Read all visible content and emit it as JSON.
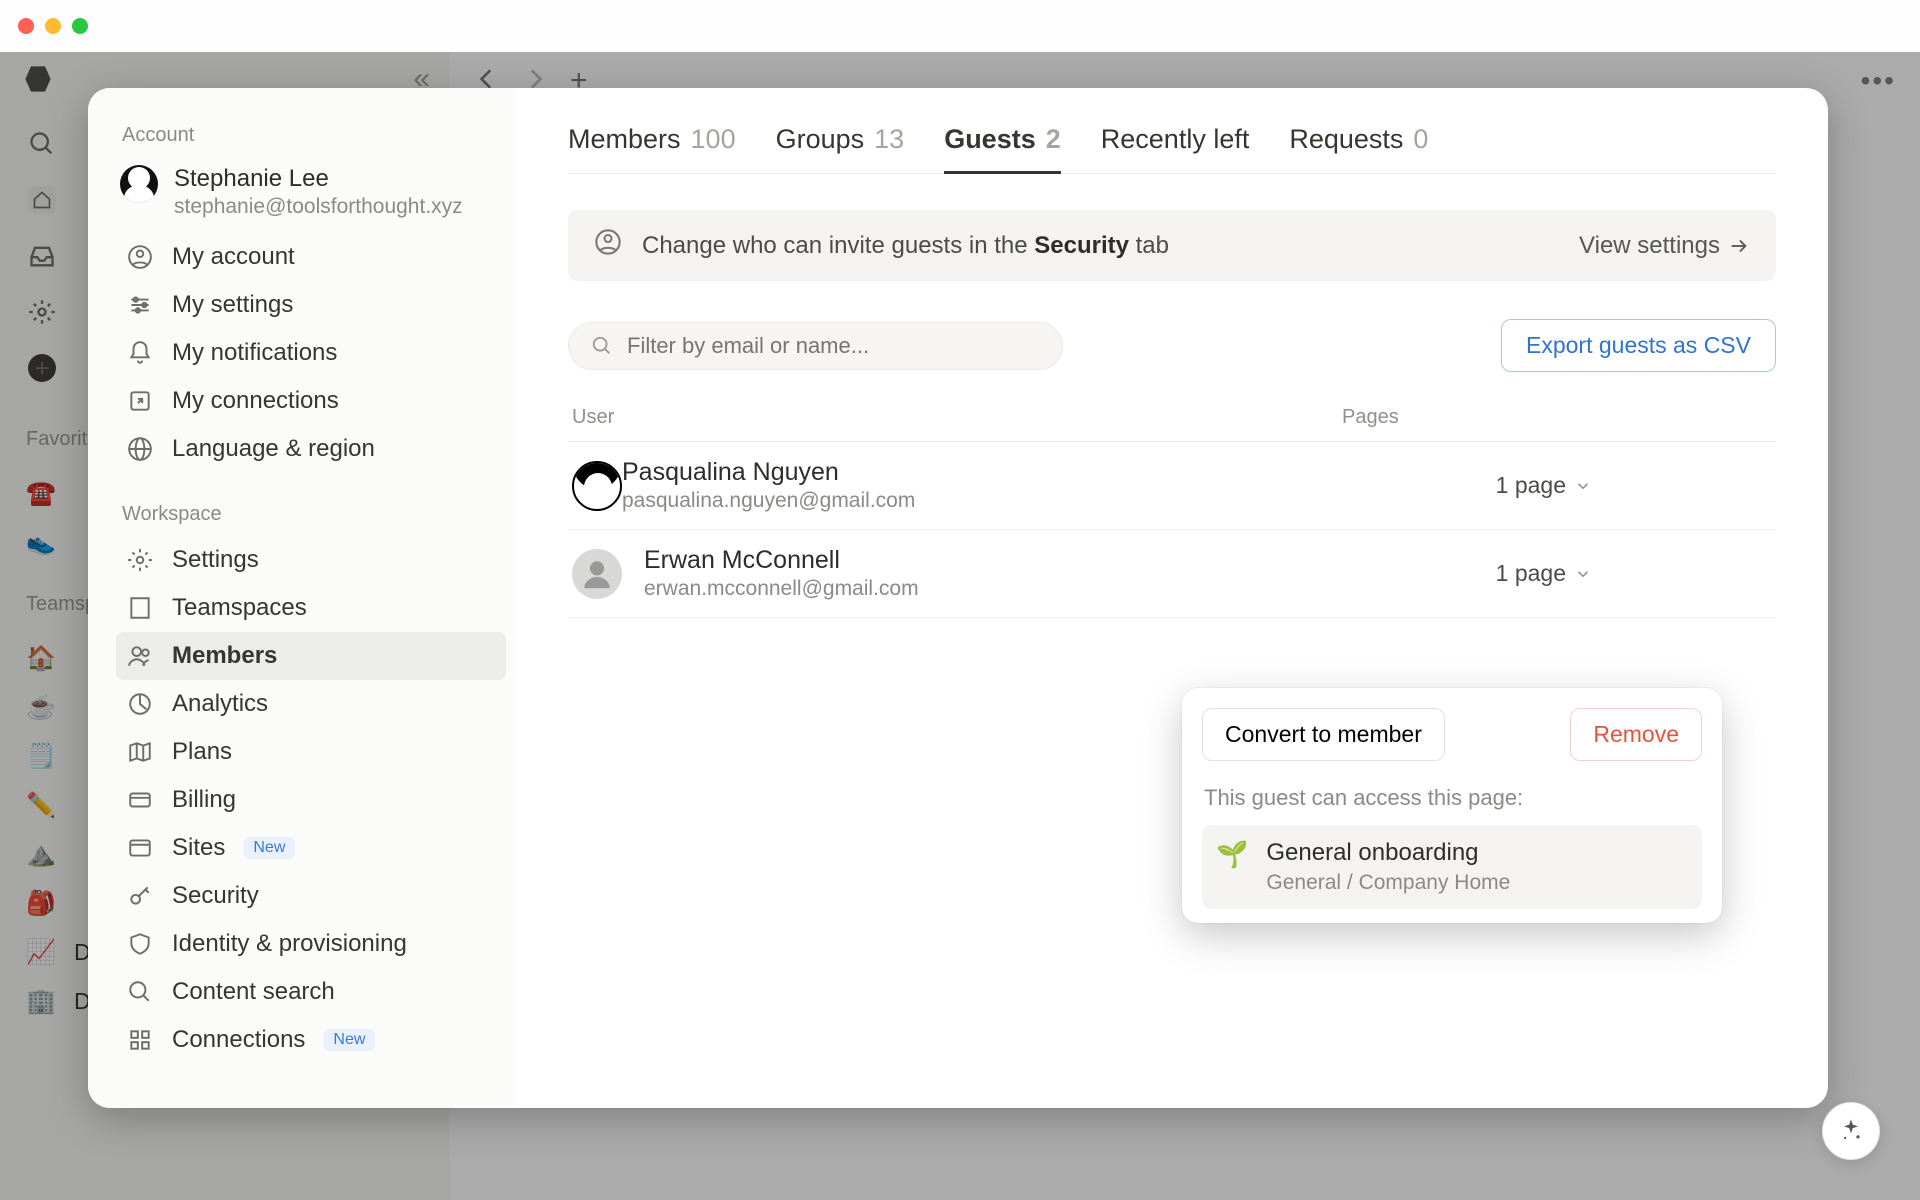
{
  "window": {
    "dots": "•••"
  },
  "app_rail": {
    "favorites_label": "Favorites",
    "teamspaces_label": "Teamspaces",
    "items": [
      {
        "emoji": "☎️",
        "label": ""
      },
      {
        "emoji": "👟",
        "label": ""
      }
    ],
    "team_items": [
      {
        "emoji": "🏠",
        "label": ""
      },
      {
        "emoji": "☕",
        "label": ""
      },
      {
        "emoji": "🗒️",
        "label": ""
      },
      {
        "emoji": "✏️",
        "label": ""
      },
      {
        "emoji": "⛰️",
        "label": ""
      },
      {
        "emoji": "🎒",
        "label": ""
      },
      {
        "emoji": "📈",
        "label": "Data"
      },
      {
        "emoji": "🏢",
        "label": "Data Home"
      }
    ]
  },
  "sidebar": {
    "section_account": "Account",
    "user": {
      "name": "Stephanie Lee",
      "email": "stephanie@toolsforthought.xyz"
    },
    "account_items": [
      {
        "key": "my-account",
        "label": "My account"
      },
      {
        "key": "my-settings",
        "label": "My settings"
      },
      {
        "key": "my-notifications",
        "label": "My notifications"
      },
      {
        "key": "my-connections",
        "label": "My connections"
      },
      {
        "key": "language",
        "label": "Language & region"
      }
    ],
    "section_workspace": "Workspace",
    "workspace_items": [
      {
        "key": "settings",
        "label": "Settings"
      },
      {
        "key": "teamspaces",
        "label": "Teamspaces"
      },
      {
        "key": "members",
        "label": "Members",
        "active": true
      },
      {
        "key": "analytics",
        "label": "Analytics"
      },
      {
        "key": "plans",
        "label": "Plans"
      },
      {
        "key": "billing",
        "label": "Billing"
      },
      {
        "key": "sites",
        "label": "Sites",
        "badge": "New"
      },
      {
        "key": "security",
        "label": "Security"
      },
      {
        "key": "identity",
        "label": "Identity & provisioning"
      },
      {
        "key": "content-search",
        "label": "Content search"
      },
      {
        "key": "connections",
        "label": "Connections",
        "badge": "New"
      }
    ]
  },
  "tabs": [
    {
      "key": "members",
      "label": "Members",
      "count": "100"
    },
    {
      "key": "groups",
      "label": "Groups",
      "count": "13"
    },
    {
      "key": "guests",
      "label": "Guests",
      "count": "2",
      "active": true
    },
    {
      "key": "recently-left",
      "label": "Recently left",
      "count": ""
    },
    {
      "key": "requests",
      "label": "Requests",
      "count": "0"
    }
  ],
  "banner": {
    "text_pre": "Change who can invite guests in the ",
    "text_bold": "Security",
    "text_post": " tab",
    "action": "View settings"
  },
  "filter": {
    "placeholder": "Filter by email or name..."
  },
  "export_label": "Export guests as CSV",
  "table": {
    "head_user": "User",
    "head_pages": "Pages",
    "rows": [
      {
        "name": "Pasqualina Nguyen",
        "email": "pasqualina.nguyen@gmail.com",
        "pages": "1 page"
      },
      {
        "name": "Erwan McConnell",
        "email": "erwan.mcconnell@gmail.com",
        "pages": "1 page"
      }
    ]
  },
  "popover": {
    "convert": "Convert to member",
    "remove": "Remove",
    "access_text": "This guest can access this page:",
    "page": {
      "emoji": "🌱",
      "title": "General onboarding",
      "crumb": "General / Company Home"
    }
  }
}
